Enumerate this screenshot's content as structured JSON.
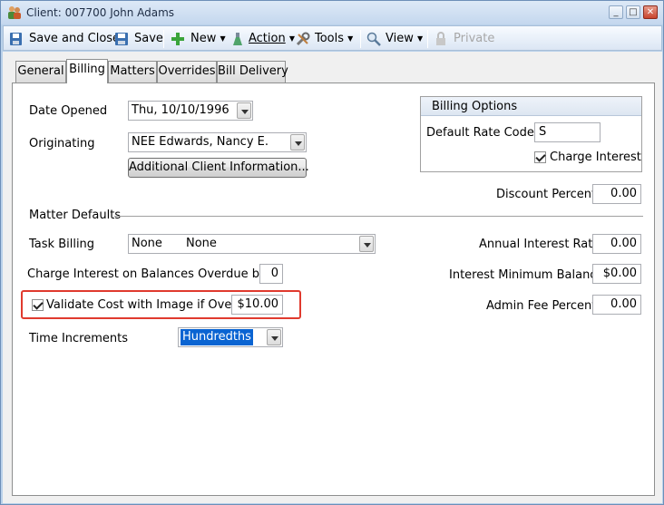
{
  "window": {
    "title": "Client: 007700 John Adams",
    "buttons": {
      "minimize": "_",
      "maximize": "□",
      "close": "✕"
    }
  },
  "toolbar": {
    "save_and_close": "Save and Close",
    "save": "Save",
    "new": "New",
    "action": "Action",
    "tools": "Tools",
    "view": "View",
    "private": "Private"
  },
  "tabs": [
    "General",
    "Billing",
    "Matters",
    "Overrides",
    "Bill Delivery"
  ],
  "active_tab": "Billing",
  "billing": {
    "date_opened_label": "Date Opened",
    "date_opened_value": "Thu, 10/10/1996",
    "originating_label": "Originating",
    "originating_value": "NEE  Edwards, Nancy E.",
    "additional_button": "Additional Client Information...",
    "matter_defaults_label": "Matter Defaults",
    "task_billing_label": "Task Billing",
    "task_billing_code": "None",
    "task_billing_value": "None",
    "charge_interest_overdue_label": "Charge Interest on Balances Overdue by",
    "charge_interest_overdue_value": "0",
    "validate_cost_label": "Validate Cost with Image if Over",
    "validate_cost_checked": true,
    "validate_cost_value": "$10.00",
    "time_increments_label": "Time Increments",
    "time_increments_value": "Hundredths"
  },
  "billing_options": {
    "header": "Billing Options",
    "default_rate_code_label": "Default Rate Code",
    "default_rate_code_value": "S",
    "charge_interest_label": "Charge Interest",
    "charge_interest_checked": true
  },
  "right_fields": {
    "discount_percent_label": "Discount Percent",
    "discount_percent_value": "0.00",
    "annual_interest_rate_label": "Annual Interest Rate",
    "annual_interest_rate_value": "0.00",
    "interest_minimum_balance_label": "Interest Minimum Balance",
    "interest_minimum_balance_value": "$0.00",
    "admin_fee_percent_label": "Admin Fee Percent",
    "admin_fee_percent_value": "0.00"
  },
  "colors": {
    "highlight": "#e03a2e",
    "selection": "#0a64d2",
    "window_frame": "#b9d1ea"
  }
}
